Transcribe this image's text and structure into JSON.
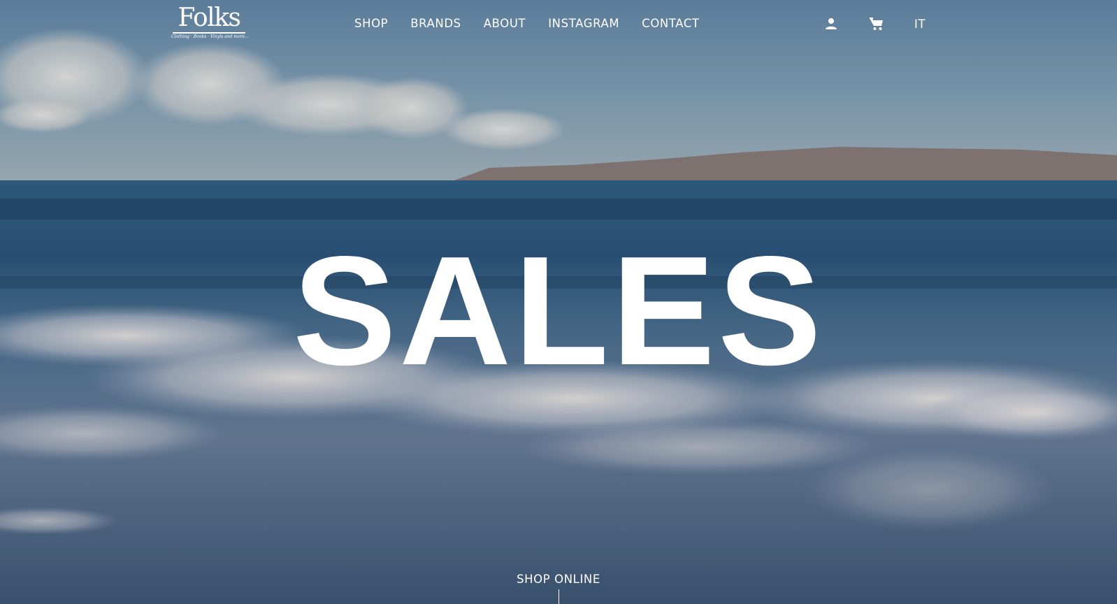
{
  "brand": {
    "name": "Folks",
    "tagline": "Clothing · Books · Vinyls and more..."
  },
  "nav": {
    "items": [
      {
        "label": "SHOP"
      },
      {
        "label": "BRANDS"
      },
      {
        "label": "ABOUT"
      },
      {
        "label": "INSTAGRAM"
      },
      {
        "label": "CONTACT"
      }
    ]
  },
  "tools": {
    "account_icon": "user-icon",
    "cart_icon": "cart-icon",
    "language": "IT"
  },
  "hero": {
    "title": "SALES",
    "cta_label": "SHOP ONLINE",
    "background": "ocean-video"
  },
  "colors": {
    "text": "#ffffff",
    "sky": "#7e9bb0",
    "sea": "#2f4f6c"
  }
}
